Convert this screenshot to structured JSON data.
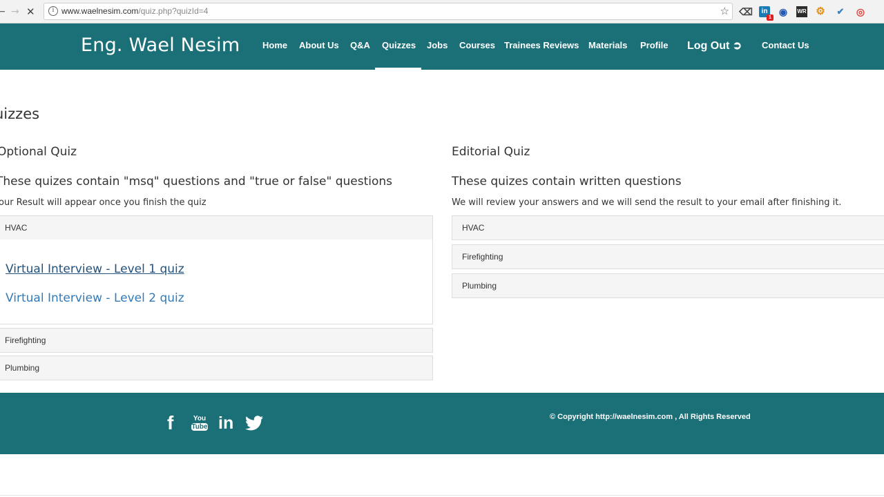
{
  "browser": {
    "url_host": "www.waelnesim.com",
    "url_path": "/quiz.php?quizId=4"
  },
  "header": {
    "brand": "Eng. Wael Nesim",
    "menu": [
      "Home",
      "About Us",
      "Q&A",
      "Quizzes",
      "Jobs",
      "Courses",
      "Trainees Reviews",
      "Materials",
      "Profile",
      "Log Out",
      "Contact Us"
    ],
    "active": "Quizzes"
  },
  "main": {
    "title": "uizzes",
    "optional": {
      "title": "Optional Quiz",
      "subtitle": "These quizes contain \"msq\" questions and \"true or false\" questions",
      "note": "our Result will appear once you finish the quiz",
      "categories": [
        "HVAC",
        "Firefighting",
        "Plumbing"
      ],
      "hvac_quizzes": [
        "Virtual Interview - Level 1 quiz",
        "Virtual Interview - Level 2 quiz"
      ]
    },
    "editorial": {
      "title": "Editorial Quiz",
      "subtitle": "These quizes contain written questions",
      "note": "We will review your answers and we will send the result to your email after finishing it.",
      "categories": [
        "HVAC",
        "Firefighting",
        "Plumbing"
      ]
    }
  },
  "footer": {
    "copyright": "© Copyright http://waelnesim.com , All Rights Reserved",
    "social": [
      "facebook-icon",
      "youtube-icon",
      "linkedin-icon",
      "twitter-icon"
    ],
    "youtube_you": "You",
    "youtube_tube": "Tube"
  },
  "colors": {
    "brand": "#1b7077",
    "link": "#337ab7"
  }
}
